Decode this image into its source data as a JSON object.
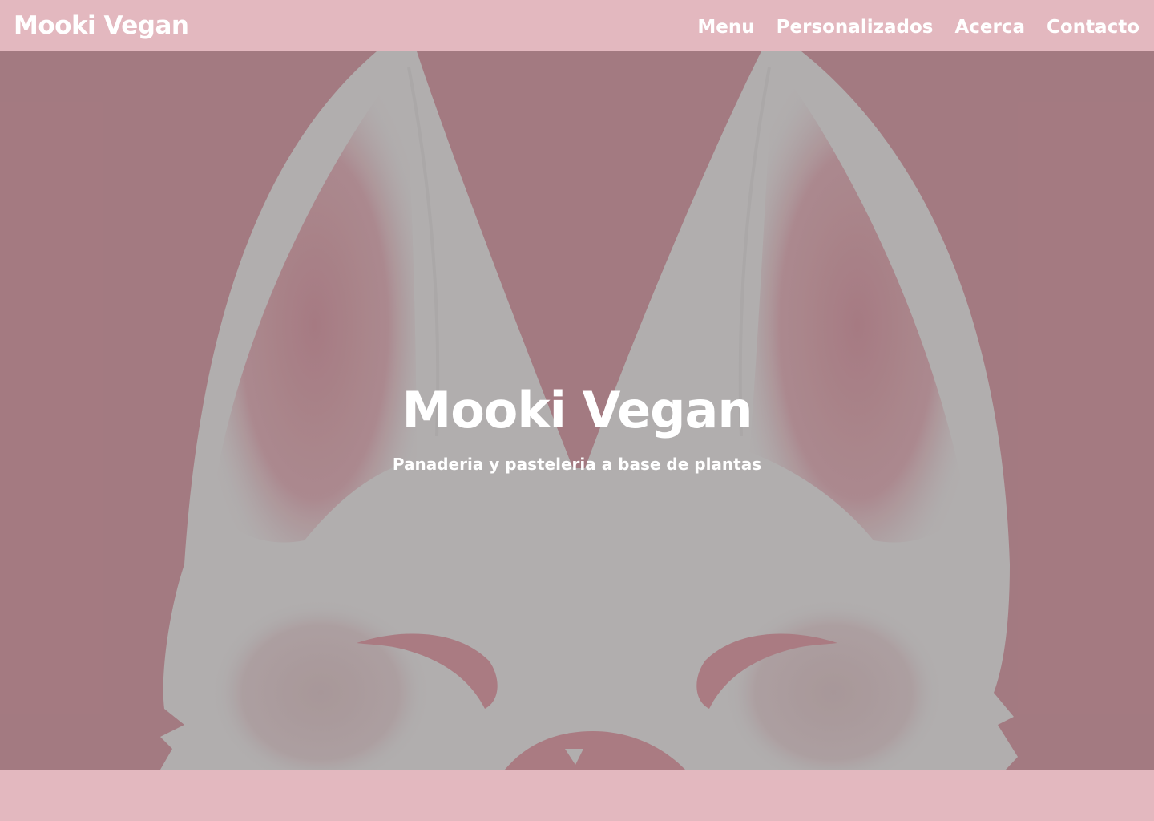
{
  "header": {
    "brand": "Mooki Vegan",
    "nav": [
      {
        "label": "Menu"
      },
      {
        "label": "Personalizados"
      },
      {
        "label": "Acerca"
      },
      {
        "label": "Contacto"
      }
    ]
  },
  "hero": {
    "title": "Mooki Vegan",
    "subtitle": "Panaderia y pasteleria a base de plantas",
    "illustration": "bunny-face-illustration"
  },
  "colors": {
    "bar_pink": "#e3b8bf",
    "hero_background": "#a67c83",
    "illustration_fill": "#b5b3b3",
    "inner_ear": "#a97c84",
    "text": "#ffffff"
  }
}
